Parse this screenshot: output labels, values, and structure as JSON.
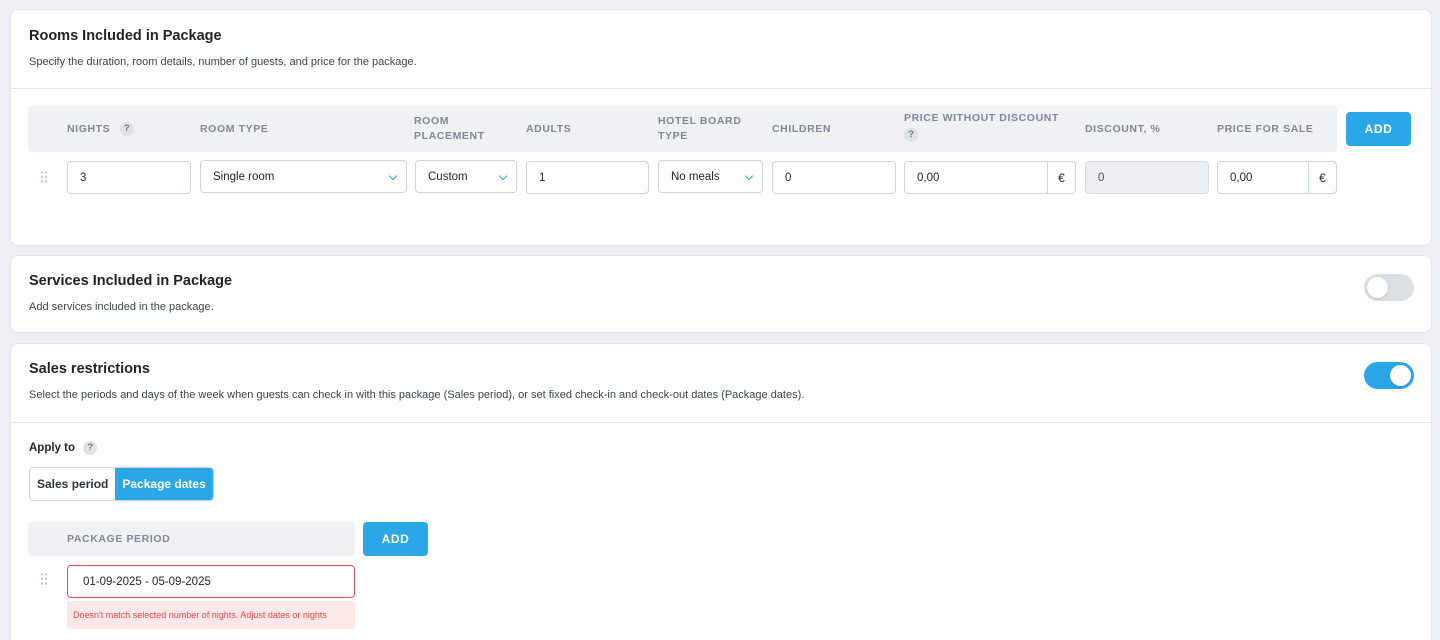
{
  "rooms": {
    "title": "Rooms Included in Package",
    "subtitle": "Specify the duration, room details, number of guests, and price for the package.",
    "columns": {
      "nights": "NIGHTS",
      "room_type": "ROOM TYPE",
      "room_placement_1": "ROOM",
      "room_placement_2": "PLACEMENT",
      "adults": "ADULTS",
      "board_1": "HOTEL BOARD",
      "board_2": "TYPE",
      "children": "CHILDREN",
      "price_without_discount": "PRICE WITHOUT DISCOUNT",
      "discount": "DISCOUNT, %",
      "price_for_sale": "PRICE FOR SALE"
    },
    "help_mark": "?",
    "add_label": "ADD",
    "row": {
      "nights": "3",
      "room_type": "Single room",
      "room_placement": "Custom",
      "adults": "1",
      "board": "No meals",
      "children": "0",
      "price_without_discount": "0,00",
      "discount": "0",
      "price_for_sale": "0,00",
      "currency": "€"
    }
  },
  "services": {
    "title": "Services Included in Package",
    "subtitle": "Add services included in the package.",
    "enabled": false
  },
  "sales": {
    "title": "Sales restrictions",
    "subtitle": "Select the periods and days of the week when guests can check in with this package (Sales period), or set fixed check-in and check-out dates (Package dates).",
    "enabled": true,
    "apply_to_label": "Apply to",
    "help_mark": "?",
    "options": [
      "Sales period",
      "Package dates"
    ],
    "active_option": "Package dates",
    "period_header": "PACKAGE PERIOD",
    "add_label": "ADD",
    "period_value": "01-09-2025 - 05-09-2025",
    "error": "Doesn't match selected number of nights. Adjust dates or nights"
  },
  "colors": {
    "accent": "#2aa7e6",
    "error": "#e0525a",
    "background": "#eef0f3"
  }
}
